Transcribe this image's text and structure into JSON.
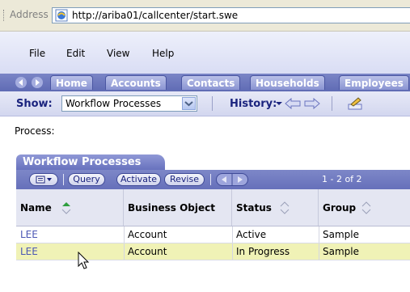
{
  "address_bar": {
    "label": "Address",
    "url": "http://ariba01/callcenter/start.swe"
  },
  "menu": {
    "items": [
      {
        "label": "File"
      },
      {
        "label": "Edit"
      },
      {
        "label": "View"
      },
      {
        "label": "Help"
      }
    ]
  },
  "tabs": {
    "items": [
      {
        "label": "Home"
      },
      {
        "label": "Accounts"
      },
      {
        "label": "Contacts"
      },
      {
        "label": "Households"
      },
      {
        "label": "Employees"
      }
    ]
  },
  "toolbar": {
    "show_label": "Show:",
    "show_value": "Workflow Processes",
    "history_label": "History:"
  },
  "process_label": "Process:",
  "applet": {
    "title": "Workflow Processes",
    "buttons": {
      "query": "Query",
      "activate": "Activate",
      "revise": "Revise"
    },
    "record_count": "1 - 2 of 2",
    "columns": [
      "Name",
      "Business Object",
      "Status",
      "Group"
    ],
    "rows": [
      {
        "name": "LEE",
        "business_object": "Account",
        "status": "Active",
        "group": "Sample",
        "selected": false
      },
      {
        "name": "LEE",
        "business_object": "Account",
        "status": "In Progress",
        "group": "Sample",
        "selected": true
      }
    ]
  },
  "colors": {
    "tab_bar": "#6670ba",
    "link": "#4b57b4",
    "selected_row": "#f0f2b6",
    "sort_active": "#2e9e3e"
  }
}
